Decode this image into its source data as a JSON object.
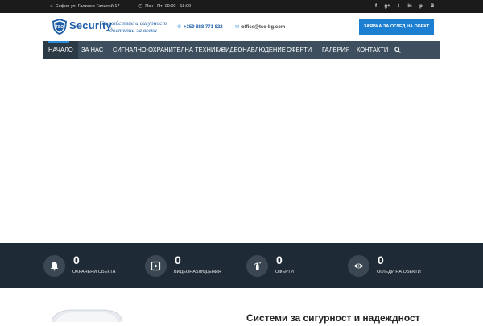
{
  "topbar": {
    "address": "София ул. Галилео Галилей 17",
    "hours": "Пон - Пт: 09:00 - 18:00",
    "social": [
      "f",
      "g+",
      "t",
      "in",
      "p",
      "B"
    ]
  },
  "header": {
    "logo_badge": "TSO",
    "logo_word": "Security",
    "slogan_line1": "Спокойствие и сигурност",
    "slogan_line2": "достъпна за всеки",
    "phone": "+359 888 771 822",
    "email": "office@tso-bg.com",
    "cta_label": "ЗАЯВКА ЗА ОГЛЕД НА ОБЕКТ"
  },
  "nav": {
    "items": [
      {
        "label": "НАЧАЛО",
        "active": true
      },
      {
        "label": "ЗА НАС",
        "active": false
      },
      {
        "label": "СИГНАЛНО-ОХРАНИТЕЛНА ТЕХНИКА",
        "active": false
      },
      {
        "label": "ВИДЕОНАБЛЮДЕНИЕ",
        "active": false
      },
      {
        "label": "ОФЕРТИ",
        "active": false
      },
      {
        "label": "ГАЛЕРИЯ",
        "active": false
      },
      {
        "label": "КОНТАКТИ",
        "active": false
      }
    ]
  },
  "stats": [
    {
      "value": "0",
      "label": "ОХРАНЕНИ ОБЕКТА",
      "icon": "bell-icon"
    },
    {
      "value": "0",
      "label": "ВИДЕОНАБЛЮДЕНИЯ",
      "icon": "play-icon"
    },
    {
      "value": "0",
      "label": "ОФЕРТИ",
      "icon": "extinguisher-icon"
    },
    {
      "value": "0",
      "label": "ОГЛЕДИ НА ОБЕКТИ",
      "icon": "eye-icon"
    }
  ],
  "section": {
    "title": "Системи за сигурност и надеждност"
  },
  "colors": {
    "topbar": "#1b1b1b",
    "nav": "#3d4f5e",
    "accent": "#1d7fd2",
    "stats_band": "#1e2b36"
  }
}
